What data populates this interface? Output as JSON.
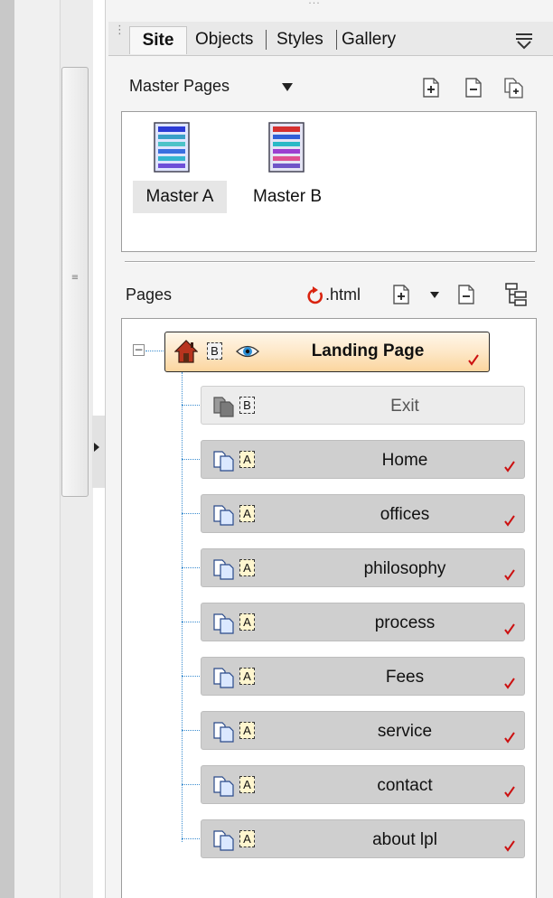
{
  "tabs": {
    "site": "Site",
    "objects": "Objects",
    "styles": "Styles",
    "gallery": "Gallery",
    "separator": "|"
  },
  "master_pages": {
    "label": "Master Pages",
    "items": [
      {
        "label": "Master A"
      },
      {
        "label": "Master B"
      }
    ]
  },
  "pages": {
    "label": "Pages",
    "html_label": ".html",
    "root": {
      "label": "Landing Page",
      "master": "B"
    },
    "items": [
      {
        "label": "Exit",
        "master": "B"
      },
      {
        "label": "Home",
        "master": "A"
      },
      {
        "label": "offices",
        "master": "A"
      },
      {
        "label": "philosophy",
        "master": "A"
      },
      {
        "label": "process",
        "master": "A"
      },
      {
        "label": "Fees",
        "master": "A"
      },
      {
        "label": "service",
        "master": "A"
      },
      {
        "label": "contact",
        "master": "A"
      },
      {
        "label": "about lpl",
        "master": "A"
      }
    ]
  },
  "colors": {
    "checkmark": "#cc1111",
    "tree_line": "#3a8ccf",
    "refresh": "#d9230f"
  }
}
